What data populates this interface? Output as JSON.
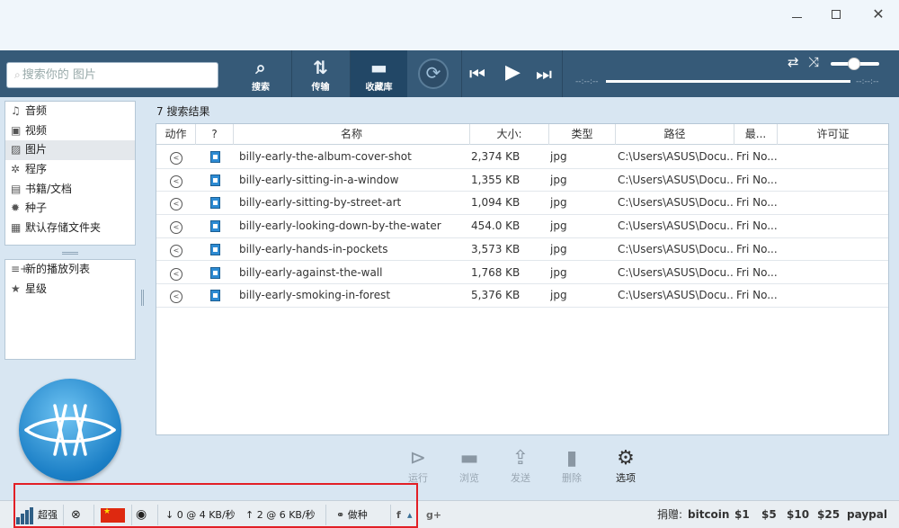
{
  "window": {
    "minimize": "—",
    "maximize": "□",
    "close": "✕"
  },
  "search": {
    "placeholder": "搜索你的 图片",
    "icon": "search-icon"
  },
  "nav": [
    {
      "label": "搜索",
      "icon": "magnifier-icon"
    },
    {
      "label": "传输",
      "icon": "transfer-arrows-icon"
    },
    {
      "label": "收藏库",
      "icon": "folder-icon"
    }
  ],
  "player": {
    "time_left": "--:--:--",
    "time_right": "--:--:--",
    "volume": 0.45
  },
  "sidebar": {
    "items": [
      {
        "label": "音频",
        "icon": "♫",
        "icon_name": "music-icon"
      },
      {
        "label": "视频",
        "icon": "▣",
        "icon_name": "video-icon"
      },
      {
        "label": "图片",
        "icon": "▨",
        "icon_name": "picture-icon"
      },
      {
        "label": "程序",
        "icon": "✲",
        "icon_name": "gear-icon"
      },
      {
        "label": "书籍/文档",
        "icon": "▤",
        "icon_name": "document-icon"
      },
      {
        "label": "种子",
        "icon": "✹",
        "icon_name": "torrent-icon"
      },
      {
        "label": "默认存储文件夹",
        "icon": "▦",
        "icon_name": "storage-folder-icon"
      }
    ],
    "playlists": [
      {
        "label": "新的播放列表",
        "icon": "≡+",
        "icon_name": "new-playlist-icon"
      },
      {
        "label": "星级",
        "icon": "★",
        "icon_name": "star-icon"
      }
    ]
  },
  "results": {
    "count_label": "7 搜索结果",
    "columns": [
      "动作",
      "?",
      "名称",
      "大小:",
      "类型",
      "路径",
      "最...",
      "许可证"
    ],
    "rows": [
      {
        "name": "billy-early-the-album-cover-shot",
        "size": "2,374 KB",
        "type": "jpg",
        "path": "C:\\Users\\ASUS\\Docu...",
        "modified": "Fri No...",
        "license": ""
      },
      {
        "name": "billy-early-sitting-in-a-window",
        "size": "1,355 KB",
        "type": "jpg",
        "path": "C:\\Users\\ASUS\\Docu...",
        "modified": "Fri No...",
        "license": ""
      },
      {
        "name": "billy-early-sitting-by-street-art",
        "size": "1,094 KB",
        "type": "jpg",
        "path": "C:\\Users\\ASUS\\Docu...",
        "modified": "Fri No...",
        "license": ""
      },
      {
        "name": "billy-early-looking-down-by-the-water",
        "size": "454.0 KB",
        "type": "jpg",
        "path": "C:\\Users\\ASUS\\Docu...",
        "modified": "Fri No...",
        "license": ""
      },
      {
        "name": "billy-early-hands-in-pockets",
        "size": "3,573 KB",
        "type": "jpg",
        "path": "C:\\Users\\ASUS\\Docu...",
        "modified": "Fri No...",
        "license": ""
      },
      {
        "name": "billy-early-against-the-wall",
        "size": "1,768 KB",
        "type": "jpg",
        "path": "C:\\Users\\ASUS\\Docu...",
        "modified": "Fri No...",
        "license": ""
      },
      {
        "name": "billy-early-smoking-in-forest",
        "size": "5,376 KB",
        "type": "jpg",
        "path": "C:\\Users\\ASUS\\Docu...",
        "modified": "Fri No...",
        "license": ""
      }
    ]
  },
  "actions": {
    "run": "运行",
    "browse": "浏览",
    "send": "发送",
    "delete": "删除",
    "options": "选项"
  },
  "status": {
    "mode": "超强",
    "download": "0 @ 4 KB/秒",
    "upload": "2 @ 6 KB/秒",
    "seed": "做种",
    "donate_label": "捐赠:",
    "donate_options": [
      "bitcoin",
      "$1",
      "$5",
      "$10",
      "$25",
      "paypal"
    ]
  },
  "colors": {
    "header": "#365a78",
    "accent": "#224766",
    "highlight_box": "#e21f26"
  }
}
